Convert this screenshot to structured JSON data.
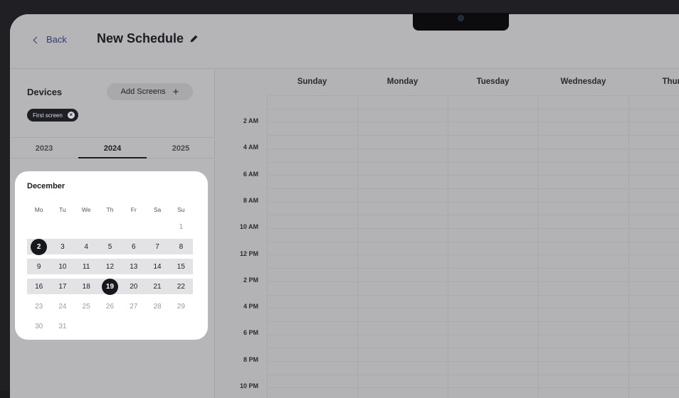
{
  "header": {
    "back_label": "Back",
    "title": "New Schedule"
  },
  "sidebar": {
    "devices_label": "Devices",
    "add_screens_label": "Add Screens",
    "chips": [
      "First screen"
    ],
    "years": [
      "2023",
      "2024",
      "2025"
    ],
    "active_year": "2024"
  },
  "calendar": {
    "month": "December",
    "weekdays": [
      "Mo",
      "Tu",
      "We",
      "Th",
      "Fr",
      "Sa",
      "Su"
    ],
    "weeks": [
      [
        "",
        "",
        "",
        "",
        "",
        "",
        "1"
      ],
      [
        "2",
        "3",
        "4",
        "5",
        "6",
        "7",
        "8"
      ],
      [
        "9",
        "10",
        "11",
        "12",
        "13",
        "14",
        "15"
      ],
      [
        "16",
        "17",
        "18",
        "19",
        "20",
        "21",
        "22"
      ],
      [
        "23",
        "24",
        "25",
        "26",
        "27",
        "28",
        "29"
      ],
      [
        "30",
        "31",
        "",
        "",
        "",
        "",
        ""
      ]
    ],
    "range_start": "2",
    "range_end": "19"
  },
  "schedule": {
    "day_headers": [
      "Sunday",
      "Monday",
      "Tuesday",
      "Wednesday",
      "Thurs"
    ],
    "time_labels": [
      "2 AM",
      "4 AM",
      "6 AM",
      "8 AM",
      "10 AM",
      "12 PM",
      "2 PM",
      "4 PM",
      "6 PM",
      "8 PM",
      "10 PM"
    ]
  },
  "colors": {
    "accent_link": "#2c3f73",
    "selected_day": "#17181d",
    "range_band": "#e3e3e5",
    "overlay_grey": "#b4b4b6"
  }
}
